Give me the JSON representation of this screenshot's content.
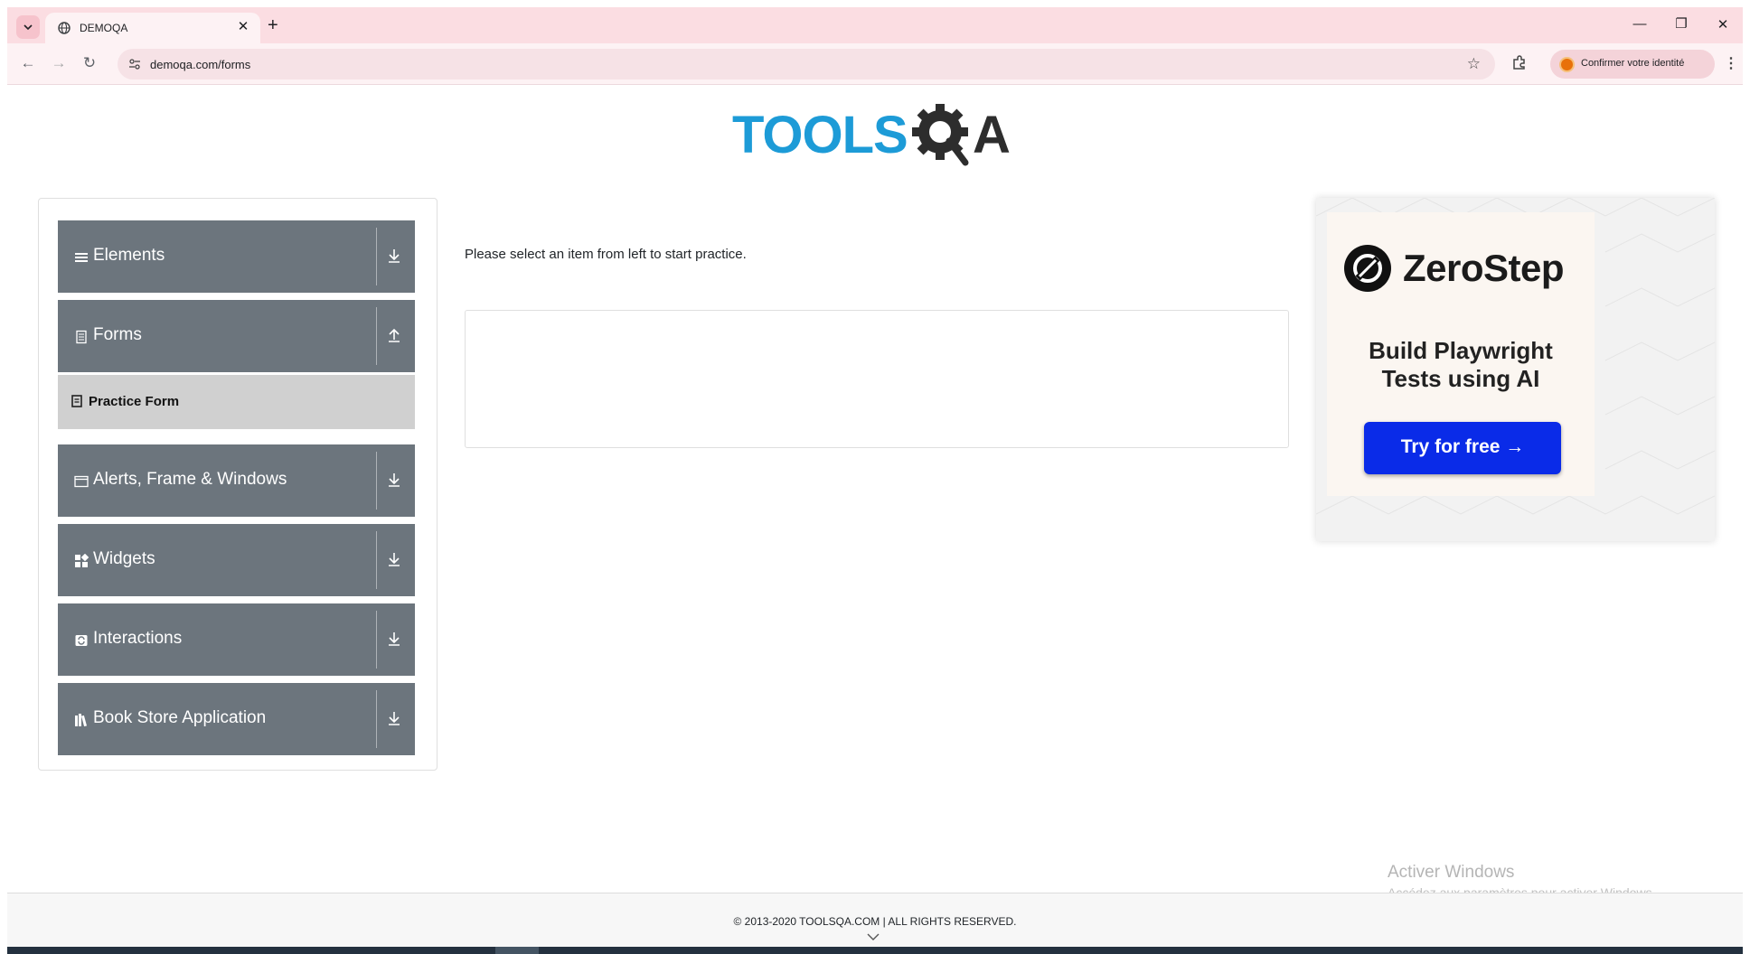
{
  "browser": {
    "tab_title": "DEMOQA",
    "url": "demoqa.com/forms",
    "profile_label": "Confirmer votre identité"
  },
  "sidebar": {
    "groups": [
      {
        "label": "Elements",
        "icon": "hamburger-icon",
        "expanded": false
      },
      {
        "label": "Forms",
        "icon": "document-icon",
        "expanded": true
      },
      {
        "label": "Alerts, Frame & Windows",
        "icon": "window-icon",
        "expanded": false
      },
      {
        "label": "Widgets",
        "icon": "widgets-icon",
        "expanded": false
      },
      {
        "label": "Interactions",
        "icon": "interactions-icon",
        "expanded": false
      },
      {
        "label": "Book Store Application",
        "icon": "books-icon",
        "expanded": false
      }
    ],
    "forms_items": [
      {
        "label": "Practice Form",
        "icon": "form-icon"
      }
    ]
  },
  "main": {
    "instruction": "Please select an item from left to start practice."
  },
  "ad": {
    "brand": "ZeroStep",
    "headline": "Build Playwright\nTests using AI",
    "cta": "Try for free →",
    "cta_color": "#0a2be8"
  },
  "watermark": {
    "title": "Activer Windows",
    "subtitle": "Accédez aux paramètres pour activer Windows."
  },
  "footer": {
    "copyright": "© 2013-2020 TOOLSQA.COM | ALL RIGHTS RESERVED."
  },
  "colors": {
    "sidebar_header_bg": "#6c757d",
    "active_item_bg": "#d0d0d0",
    "logo_blue": "#1d9bd7",
    "logo_dark": "#2d2d2d",
    "chrome_tab_bg": "#fbdde2"
  }
}
